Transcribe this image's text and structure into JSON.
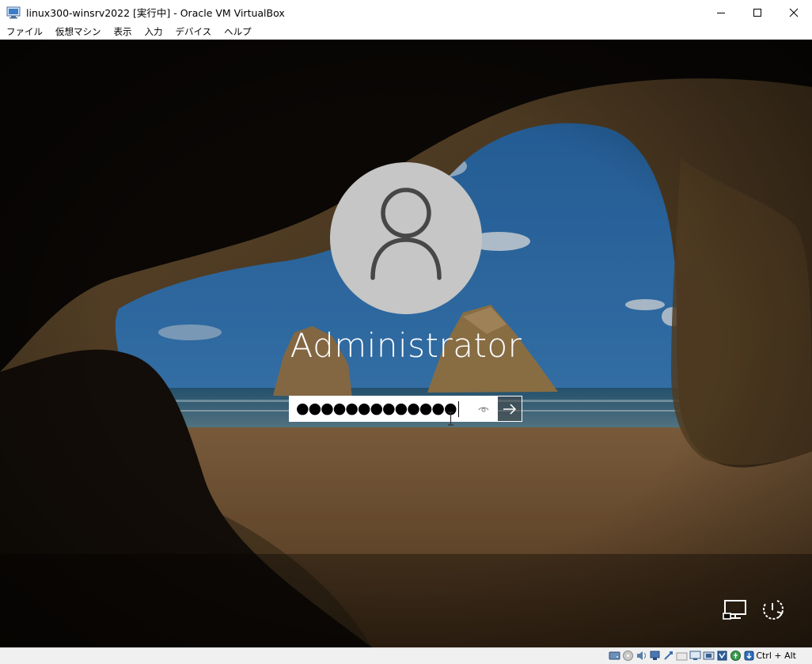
{
  "window": {
    "title": "linux300-winsrv2022 [実行中] - Oracle VM VirtualBox",
    "controls": [
      "minimize",
      "maximize",
      "close"
    ]
  },
  "menu": {
    "items": [
      "ファイル",
      "仮想マシン",
      "表示",
      "入力",
      "デバイス",
      "ヘルプ"
    ]
  },
  "login": {
    "username": "Administrator",
    "password_mask": "●●●●●●●●●●●●●",
    "reveal_icon": "eye-icon",
    "submit_icon": "arrow-right-icon",
    "network_icon": "network-icon",
    "power_icon": "power-icon"
  },
  "statusbar": {
    "icons": [
      "hard-disk-icon",
      "optical-drive-icon",
      "audio-icon",
      "network-adapter-icon",
      "usb-icon",
      "shared-folders-icon",
      "display-icon",
      "recording-icon",
      "vt-x-icon",
      "mouse-integration-icon",
      "keyboard-capture-icon"
    ],
    "host_key": "Ctrl + Alt"
  },
  "colors": {
    "accent": "#ffffff",
    "avatar_bg": "#c6c6c6",
    "sky": "#2e6ea8",
    "sand": "#8a5f35"
  }
}
